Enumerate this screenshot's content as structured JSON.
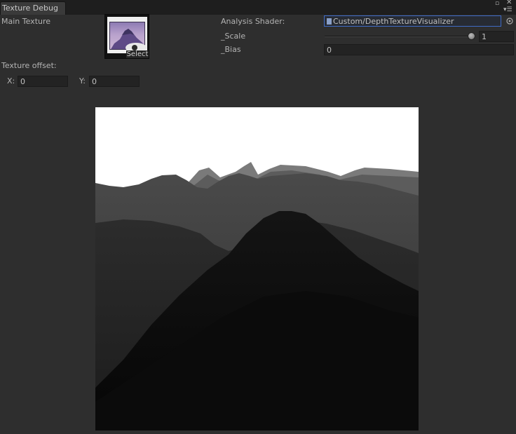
{
  "window": {
    "tab_title": "Texture Debug"
  },
  "main_texture": {
    "label": "Main Texture",
    "select_label": "Select"
  },
  "shader": {
    "label": "Analysis Shader:",
    "value": "Custom/DepthTextureVisualizer"
  },
  "scale": {
    "label": "_Scale",
    "value": "1",
    "slider_fraction": 1.0
  },
  "bias": {
    "label": "_Bias",
    "value": "0"
  },
  "offset": {
    "label": "Texture offset:",
    "x_label": "X:",
    "x_value": "0",
    "y_label": "Y:",
    "y_value": "0"
  },
  "colors": {
    "panel_bg": "#2e2e2e",
    "field_bg": "#232323",
    "selection_border": "#3f6bc6",
    "text": "#b4b4b4"
  }
}
